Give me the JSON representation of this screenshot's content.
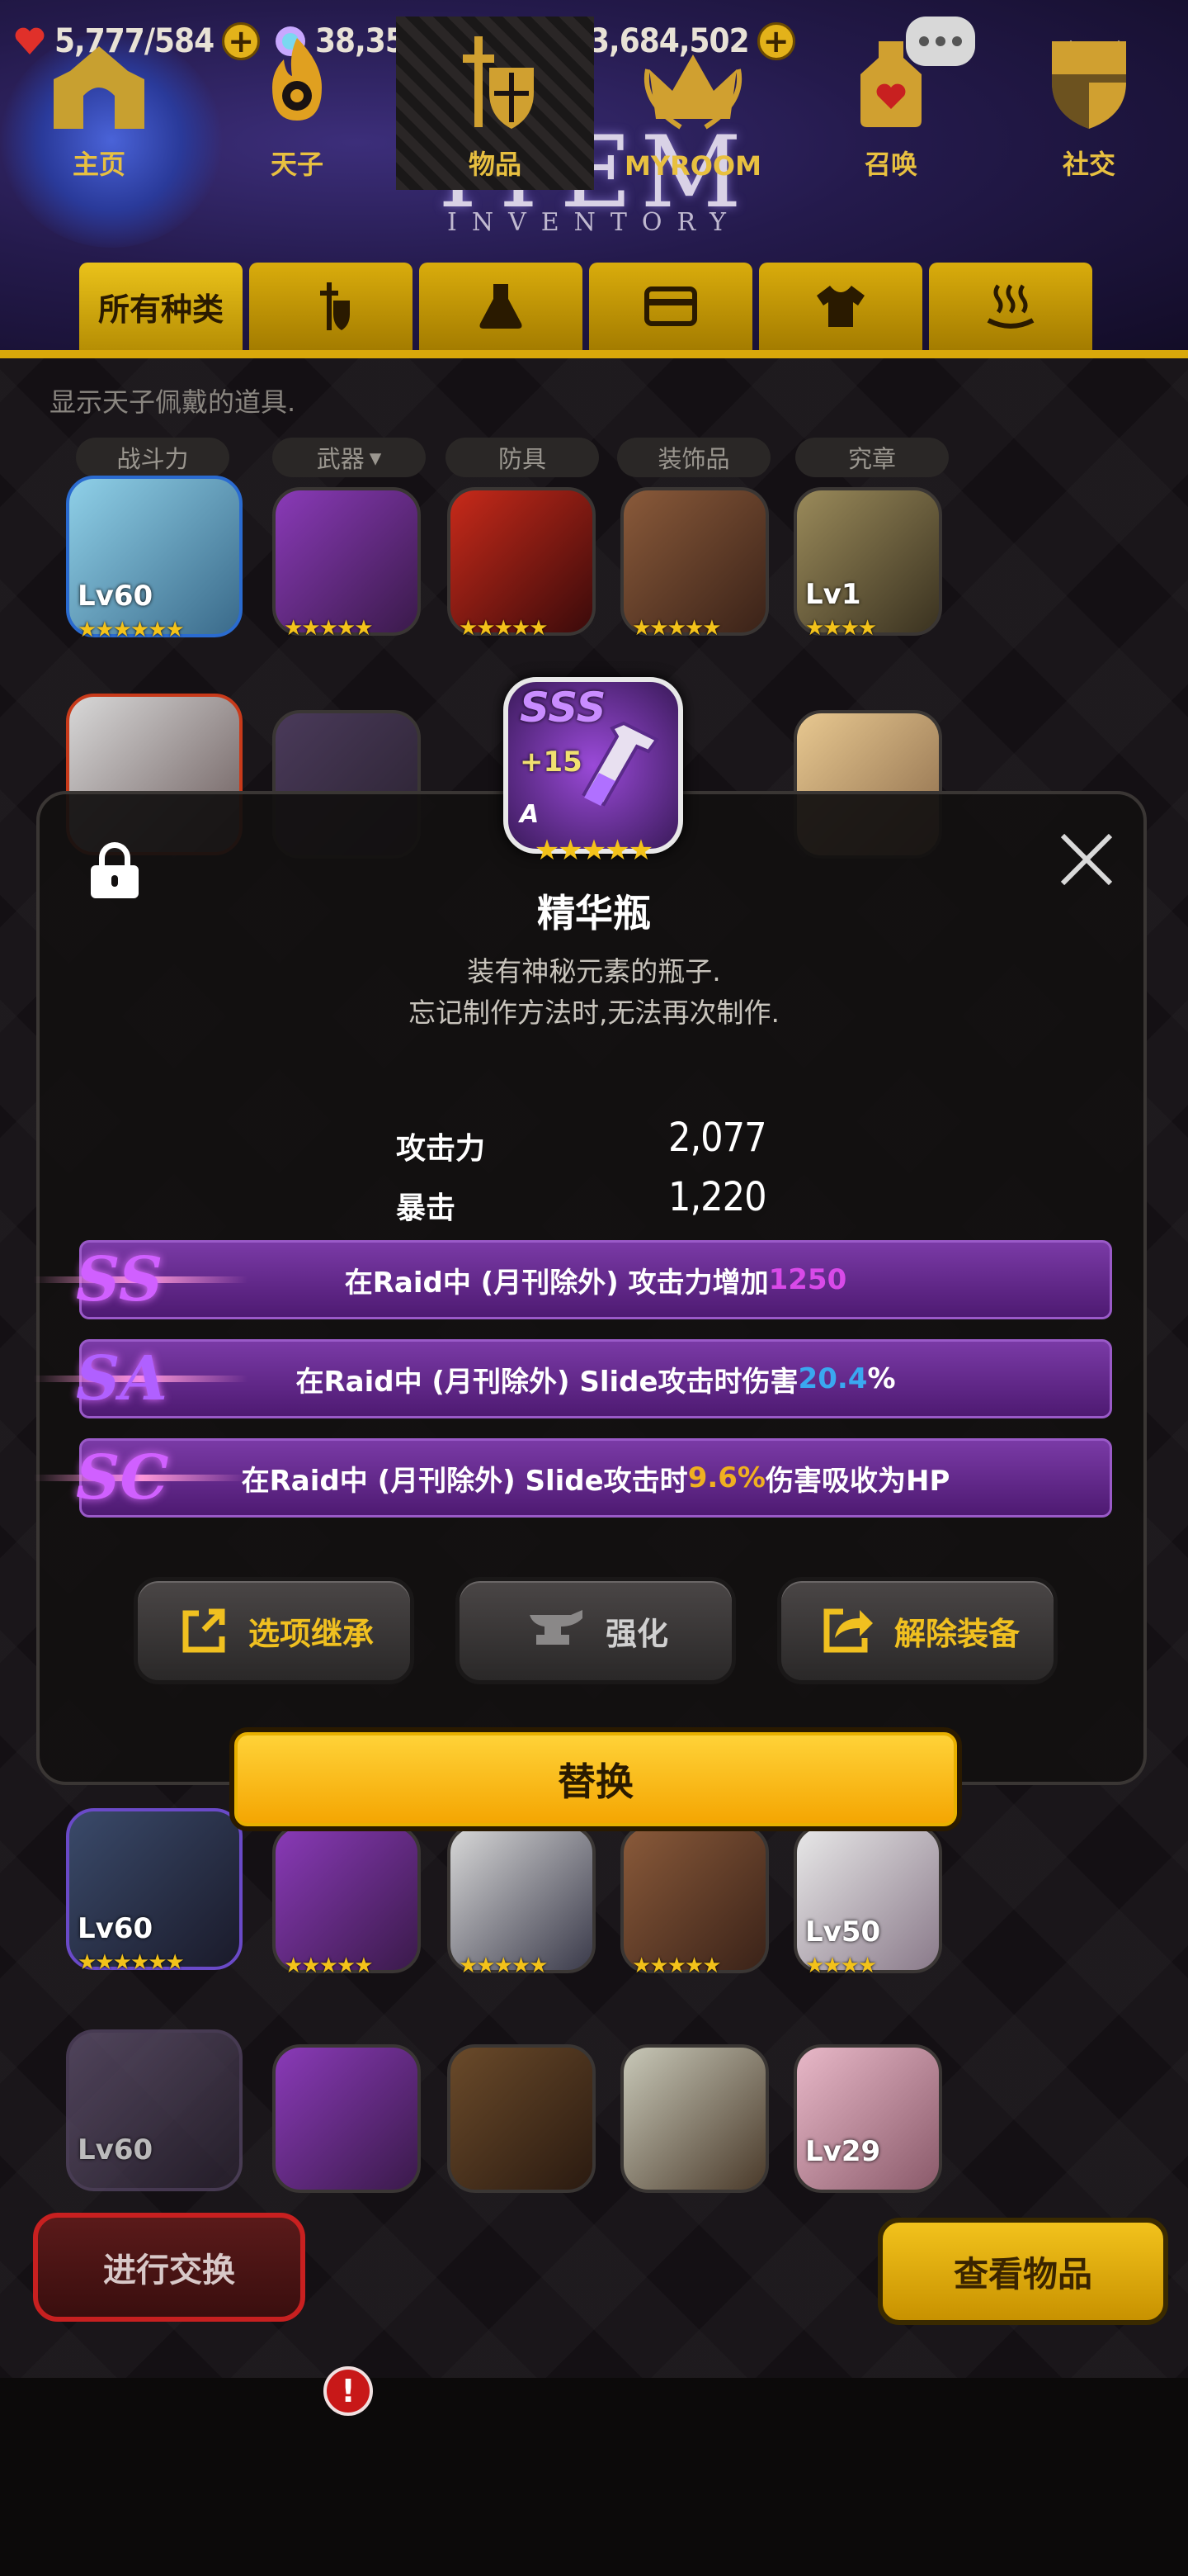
{
  "header": {
    "resources": [
      {
        "name": "stamina",
        "icon": "heart-icon",
        "value": "5,777",
        "max": "584"
      },
      {
        "name": "gems",
        "icon": "gem-icon",
        "value": "38,354"
      },
      {
        "name": "gold",
        "icon": "coin-icon",
        "value": "3,684,502"
      }
    ],
    "title": "ITEM",
    "subtitle": "INVENTORY"
  },
  "tabs": [
    {
      "label": "所有种类",
      "icon": "all-categories-text"
    },
    {
      "label": "",
      "icon": "knight-icon"
    },
    {
      "label": "",
      "icon": "flask-icon"
    },
    {
      "label": "",
      "icon": "card-icon"
    },
    {
      "label": "",
      "icon": "shirt-icon"
    },
    {
      "label": "",
      "icon": "hot-spring-icon"
    }
  ],
  "inventory": {
    "hint": "显示天子佩戴的道具.",
    "categories": [
      "战斗力",
      "武器",
      "防具",
      "装饰品",
      "究章"
    ],
    "visible_levels": [
      "Lv60",
      "Lv1",
      "Lv60",
      "Lv50",
      "Lv60",
      "Lv29"
    ]
  },
  "popup": {
    "item": {
      "grade": "SSS",
      "enhance": "+15",
      "rank": "A",
      "stars": "★★★★★",
      "name": "精华瓶",
      "desc_line1": "装有神秘元素的瓶子.",
      "desc_line2": "忘记制作方法时,无法再次制作."
    },
    "stats": [
      {
        "label": "攻击力",
        "value": "2,077"
      },
      {
        "label": "暴击",
        "value": "1,220"
      }
    ],
    "options": [
      {
        "grade": "SS",
        "prefix": "在Raid中 (月刊除外) 攻击力增加 ",
        "value": "1250",
        "suffix": ""
      },
      {
        "grade": "SA",
        "prefix": "在Raid中 (月刊除外) Slide攻击时伤害 ",
        "value": "20.4",
        "suffix": "%"
      },
      {
        "grade": "SC",
        "prefix": "在Raid中 (月刊除外) Slide攻击时 ",
        "value": "9.6%",
        "suffix": " 伤害吸收为HP"
      }
    ],
    "buttons": {
      "inherit": "选项继承",
      "enhance": "强化",
      "unequip": "解除装备",
      "replace": "替换"
    }
  },
  "bottom": {
    "trade": "进行交换",
    "view": "查看物品"
  },
  "nav": {
    "items": [
      {
        "label": "主页",
        "icon": "home-icon"
      },
      {
        "label": "天子",
        "icon": "flame-icon"
      },
      {
        "label": "物品",
        "icon": "sword-shield-icon"
      },
      {
        "label": "MYROOM",
        "icon": "crown-icon"
      },
      {
        "label": "召唤",
        "icon": "potion-icon"
      },
      {
        "label": "社交",
        "icon": "shield-icon"
      }
    ],
    "active": "物品",
    "alert_badge": "!"
  },
  "colors": {
    "gold": "#e3b21a",
    "option_bg": "#6a2a96",
    "highlight_purple": "#d84ae8",
    "highlight_blue": "#3aa8f0",
    "highlight_orange": "#f0b020"
  }
}
